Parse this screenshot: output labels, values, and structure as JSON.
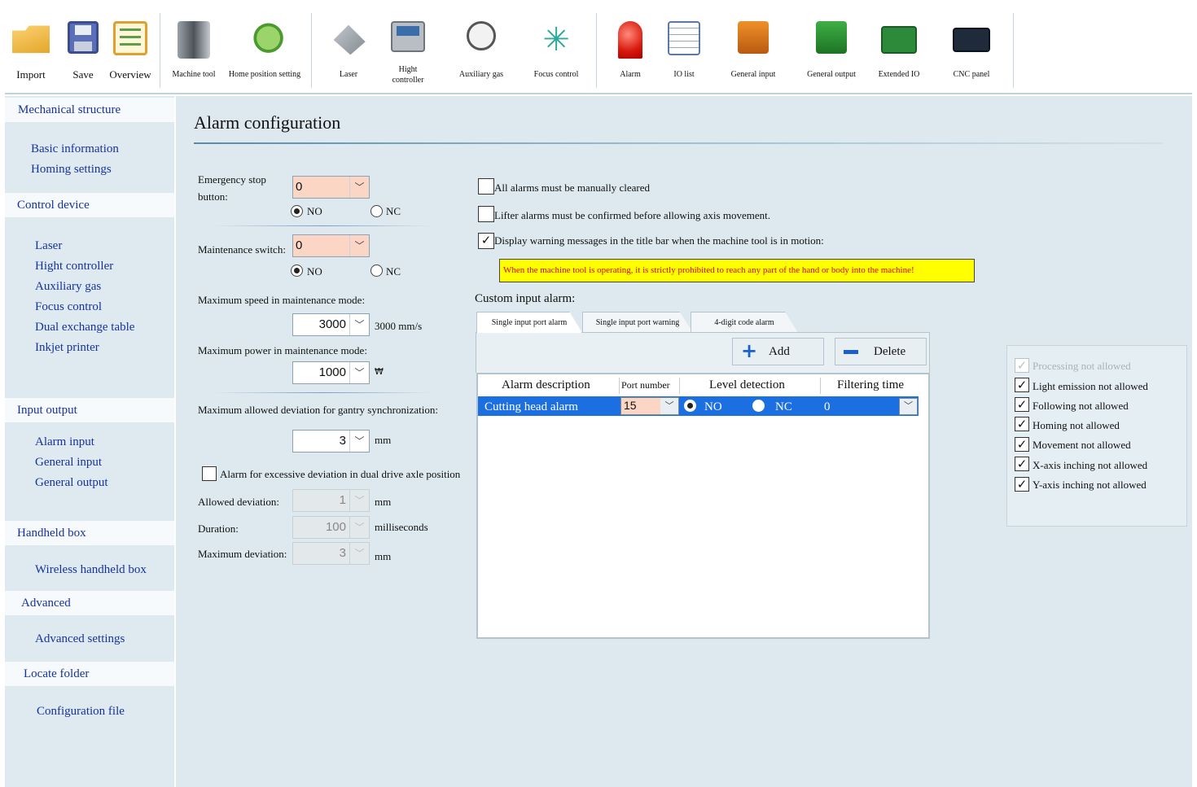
{
  "toolbar": {
    "import": "Import",
    "save": "Save",
    "overview": "Overview",
    "machine_tool": "Machine tool",
    "home_position": "Home position setting",
    "laser": "Laser",
    "hight_controller_1": "Hight",
    "hight_controller_2": "controller",
    "auxiliary_gas": "Auxiliary gas",
    "focus_control": "Focus control",
    "alarm": "Alarm",
    "io_list": "IO list",
    "general_input": "General input",
    "general_output": "General output",
    "extended_io": "Extended IO",
    "cnc_panel": "CNC panel"
  },
  "sidebar": {
    "mechanical_structure": "Mechanical structure",
    "basic_information": "Basic information",
    "homing_settings": "Homing settings",
    "control_device": "Control device",
    "laser": "Laser",
    "hight_controller": "Hight controller",
    "auxiliary_gas": "Auxiliary gas",
    "focus_control": "Focus control",
    "dual_exchange_table": "Dual exchange table",
    "inkjet_printer": "Inkjet printer",
    "input_output": "Input output",
    "alarm_input": "Alarm input",
    "general_input": "General input",
    "general_output": "General output",
    "handheld_box": "Handheld box",
    "wireless_handheld_box": "Wireless handheld box",
    "advanced": "Advanced",
    "advanced_settings": "Advanced settings",
    "locate_folder": "Locate folder",
    "configuration_file": "Configuration file"
  },
  "page": {
    "title": "Alarm configuration"
  },
  "left_form": {
    "estop_label_1": "Emergency stop",
    "estop_label_2": "button:",
    "estop_value": "0",
    "no": "NO",
    "nc": "NC",
    "maint_label": "Maintenance switch:",
    "maint_value": "0",
    "max_speed_label": "Maximum speed in maintenance mode:",
    "max_speed_value": "3000",
    "max_speed_unit": "3000 mm/s",
    "max_power_label": "Maximum power in maintenance mode:",
    "max_power_value": "1000",
    "max_power_unit": "₩",
    "gantry_label": "Maximum allowed deviation for gantry synchronization:",
    "gantry_value": "3",
    "gantry_unit": "mm",
    "dual_drive_label": "Alarm for excessive deviation in dual drive axle position",
    "allowed_dev_label": "Allowed deviation:",
    "allowed_dev_value": "1",
    "allowed_dev_unit": "mm",
    "duration_label": "Duration:",
    "duration_value": "100",
    "duration_unit": "milliseconds",
    "max_dev_label": "Maximum deviation:",
    "max_dev_value": "3",
    "max_dev_unit": "mm"
  },
  "options": {
    "manual_clear": "All alarms must be manually cleared",
    "lifter_confirm": "Lifter alarms must be confirmed before allowing axis movement.",
    "display_warning": "Display warning messages in the title bar when the machine tool is in motion:",
    "warning_text": "When the machine tool is operating, it is strictly prohibited to reach any part of the hand or body into the machine!"
  },
  "custom_alarm": {
    "heading": "Custom input alarm:",
    "tabs": [
      "Single input port alarm",
      "Single input port warning",
      "4-digit code alarm"
    ],
    "add": "Add",
    "delete": "Delete",
    "columns": [
      "Alarm description",
      "Port number",
      "Level detection",
      "Filtering time"
    ],
    "row": {
      "description": "Cutting head alarm",
      "port": "15",
      "no": "NO",
      "nc": "NC",
      "filter": "0"
    }
  },
  "restrictions": {
    "processing": "Processing not allowed",
    "light": "Light emission not allowed",
    "following": "Following not allowed",
    "homing": "Homing not allowed",
    "movement": "Movement not allowed",
    "x_inching": "X-axis inching not allowed",
    "y_inching": "Y-axis inching not allowed"
  },
  "colors": {
    "sidebar_link": "#17339b",
    "selection": "#1c6fe0",
    "warning_bg": "#ffff00",
    "warning_text": "#e00000",
    "orange_field": "#fbd6c4",
    "main_bg": "#dde9ef"
  }
}
